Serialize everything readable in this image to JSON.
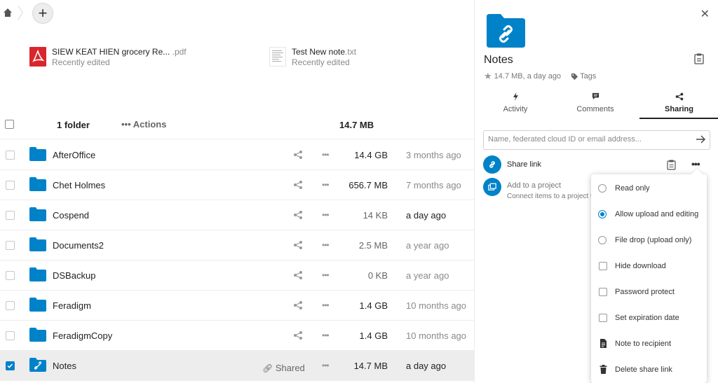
{
  "breadcrumb": {
    "home_icon": "home-icon",
    "add_icon": "+"
  },
  "recent": [
    {
      "name": "SIEW KEAT HIEN grocery Re...",
      "ext": ".pdf",
      "sub": "Recently edited",
      "icon": "pdf-icon"
    },
    {
      "name": "Test New note",
      "ext": ".txt",
      "sub": "Recently edited",
      "icon": "text-file-icon"
    }
  ],
  "list_header": {
    "count": "1 folder",
    "actions": "Actions",
    "actions_icon": "•••",
    "total_size": "14.7 MB"
  },
  "files": [
    {
      "name": "AfterOffice",
      "size": "14.4 GB",
      "date": "3 months ago",
      "more": "•••"
    },
    {
      "name": "Chet Holmes",
      "size": "656.7 MB",
      "date": "7 months ago",
      "more": "•••"
    },
    {
      "name": "Cospend",
      "size": "14 KB",
      "date": "a day ago",
      "more": "•••"
    },
    {
      "name": "Documents2",
      "size": "2.5 MB",
      "date": "a year ago",
      "more": "•••"
    },
    {
      "name": "DSBackup",
      "size": "0 KB",
      "date": "a year ago",
      "more": "•••"
    },
    {
      "name": "Feradigm",
      "size": "1.4 GB",
      "date": "10 months ago",
      "more": "•••"
    },
    {
      "name": "FeradigmCopy",
      "size": "1.4 GB",
      "date": "10 months ago",
      "more": "•••"
    },
    {
      "name": "Notes",
      "size": "14.7 MB",
      "date": "a day ago",
      "more": "•••",
      "shared_label": "Shared"
    }
  ],
  "sidebar": {
    "close": "✕",
    "title": "Notes",
    "meta": "14.7 MB, a day ago",
    "tags_label": "Tags",
    "tabs": [
      {
        "label": "Activity",
        "icon": "lightning-icon"
      },
      {
        "label": "Comments",
        "icon": "comment-icon"
      },
      {
        "label": "Sharing",
        "icon": "share-icon"
      }
    ],
    "share_placeholder": "Name, federated cloud ID or email address...",
    "share_link_label": "Share link",
    "share_link_more": "•••",
    "project_label": "Add to a project",
    "project_sub": "Connect items to a project to"
  },
  "share_menu": {
    "items": [
      {
        "label": "Read only",
        "type": "radio",
        "checked": false
      },
      {
        "label": "Allow upload and editing",
        "type": "radio",
        "checked": true
      },
      {
        "label": "File drop (upload only)",
        "type": "radio",
        "checked": false
      },
      {
        "label": "Hide download",
        "type": "checkbox",
        "checked": false
      },
      {
        "label": "Password protect",
        "type": "checkbox",
        "checked": false
      },
      {
        "label": "Set expiration date",
        "type": "checkbox",
        "checked": false
      },
      {
        "label": "Note to recipient",
        "type": "action",
        "icon": "note-icon"
      },
      {
        "label": "Delete share link",
        "type": "action",
        "icon": "trash-icon"
      }
    ]
  },
  "colors": {
    "accent": "#0082c9",
    "folder": "#0082c9",
    "pdf": "#d9262c"
  }
}
